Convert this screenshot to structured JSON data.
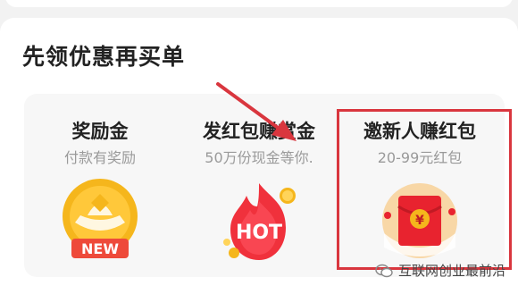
{
  "section": {
    "title": "先领优惠再买单"
  },
  "cards": [
    {
      "title": "奖励金",
      "subtitle": "付款有奖励",
      "icon": "gold-ingot-coin-icon",
      "badge": "NEW"
    },
    {
      "title": "发红包赚赏金",
      "subtitle": "50万份现金等你.",
      "icon": "hot-fire-icon",
      "badge": "HOT"
    },
    {
      "title": "邀新人赚红包",
      "subtitle": "20-99元红包",
      "icon": "red-envelope-icon",
      "badge": "¥"
    }
  ],
  "annotation": {
    "arrow_color": "#d9363e",
    "box_color": "#d9363e"
  },
  "watermark": {
    "text": "互联网创业最前沿",
    "icon": "wechat-icon"
  },
  "colors": {
    "accent_red": "#e8232f",
    "gold": "#f5b61c",
    "text_primary": "#222222",
    "text_secondary": "#9a9a9a"
  }
}
